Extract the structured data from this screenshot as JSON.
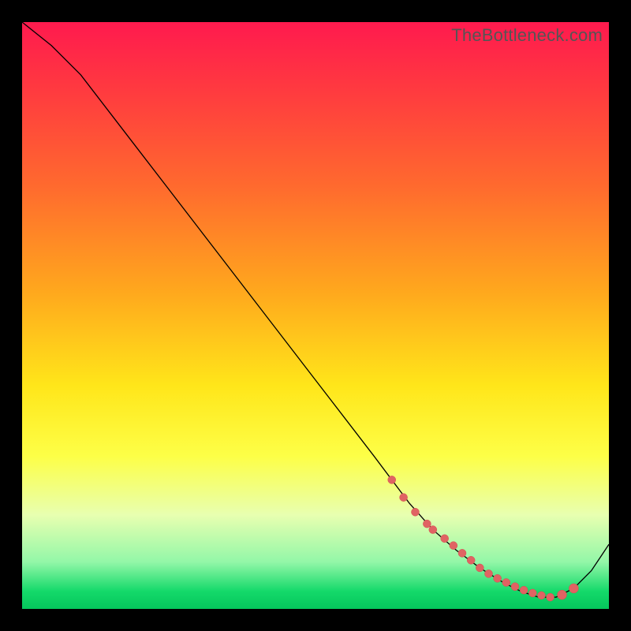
{
  "watermark": "TheBottleneck.com",
  "colors": {
    "background": "#000000",
    "curve": "#000000",
    "marker": "#e06363"
  },
  "chart_data": {
    "type": "line",
    "title": "",
    "xlabel": "",
    "ylabel": "",
    "xlim": [
      0,
      100
    ],
    "ylim": [
      0,
      100
    ],
    "grid": false,
    "legend": false,
    "series": [
      {
        "name": "bottleneck-curve",
        "x": [
          0,
          5,
          10,
          15,
          20,
          25,
          30,
          35,
          40,
          45,
          50,
          55,
          60,
          63,
          66,
          70,
          74,
          78,
          82,
          85,
          88,
          91,
          94,
          97,
          100
        ],
        "y": [
          100,
          96,
          91,
          84.5,
          78,
          71.5,
          65,
          58.5,
          52,
          45.5,
          39,
          32.5,
          26,
          22,
          18,
          13.5,
          10,
          7,
          4.5,
          3,
          2,
          2,
          3.5,
          6.5,
          11
        ]
      }
    ],
    "markers": {
      "name": "highlight-points",
      "x": [
        63,
        65,
        67,
        69,
        70,
        72,
        73.5,
        75,
        76.5,
        78,
        79.5,
        81,
        82.5,
        84,
        85.5,
        87,
        88.5,
        90,
        92,
        94
      ],
      "y": [
        22,
        19,
        16.5,
        14.5,
        13.5,
        12,
        10.8,
        9.5,
        8.3,
        7,
        6,
        5.2,
        4.5,
        3.8,
        3.2,
        2.7,
        2.3,
        2,
        2.4,
        3.5
      ],
      "r": [
        5,
        5,
        5,
        5,
        5,
        5,
        5,
        5,
        5,
        5,
        5,
        5,
        5,
        5,
        5,
        5,
        5,
        5,
        6,
        6
      ]
    }
  }
}
